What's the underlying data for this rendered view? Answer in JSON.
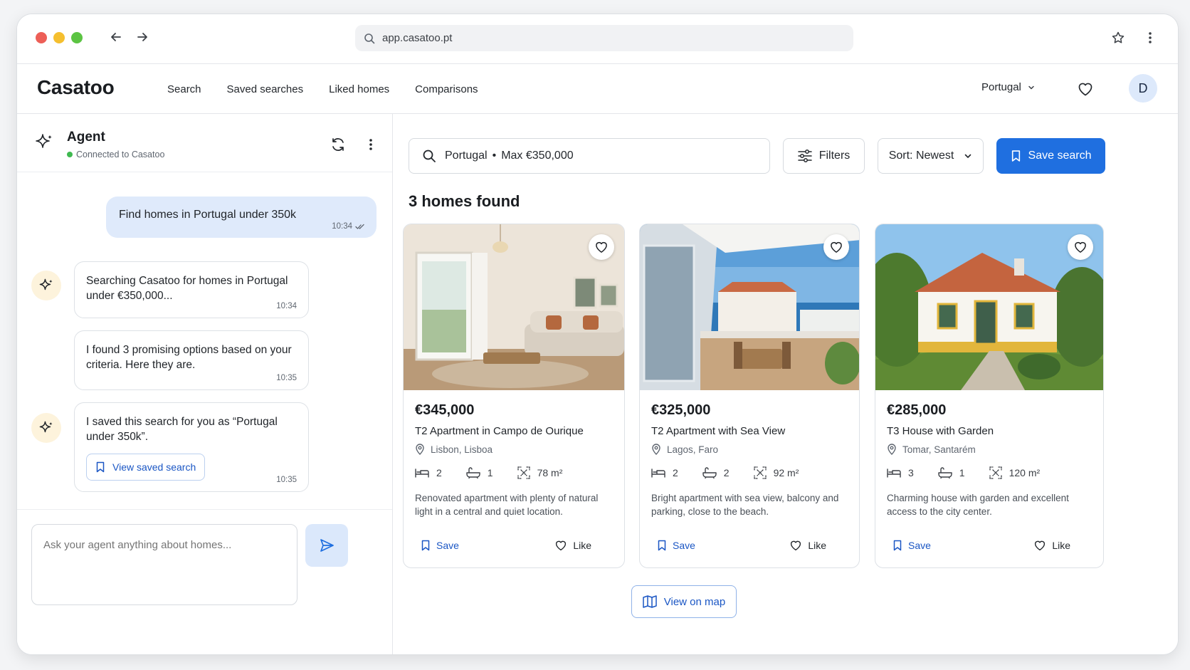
{
  "browser": {
    "url": "app.casatoo.pt"
  },
  "app": {
    "logo": "Casatoo",
    "nav": [
      "Search",
      "Saved searches",
      "Liked homes",
      "Comparisons"
    ],
    "country": "Portugal",
    "avatar_initial": "D"
  },
  "chat": {
    "title": "Agent",
    "status": "Connected to Casatoo",
    "user_message": {
      "text": "Find homes in Portugal under 350k",
      "time": "10:34"
    },
    "agent_messages": [
      {
        "text": "Searching Casatoo for homes in Portugal under €350,000...",
        "time": "10:34"
      },
      {
        "text": "I found 3 promising options based on your criteria. Here they are.",
        "time": "10:35"
      },
      {
        "text": "I saved this search for you as “Portugal under 350k”.",
        "time": "10:35",
        "button": "View saved search"
      }
    ],
    "input_placeholder": "Ask your agent anything about homes..."
  },
  "results": {
    "query_location": "Portugal",
    "query_separator": "•",
    "query_price": "Max €350,000",
    "filters_label": "Filters",
    "sort_label": "Sort: Newest",
    "save_search_label": "Save search",
    "count_label": "3 homes found",
    "map_button": "View on map",
    "listings": [
      {
        "price": "€345,000",
        "title": "T2 Apartment in Campo de Ourique",
        "location": "Lisbon, Lisboa",
        "beds": "2",
        "baths": "1",
        "area": "78 m²",
        "description": "Renovated apartment with plenty of natural light in a central and quiet location.",
        "save_label": "Save",
        "like_label": "Like"
      },
      {
        "price": "€325,000",
        "title": "T2 Apartment with Sea View",
        "location": "Lagos, Faro",
        "beds": "2",
        "baths": "2",
        "area": "92 m²",
        "description": "Bright apartment with sea view, balcony and parking, close to the beach.",
        "save_label": "Save",
        "like_label": "Like"
      },
      {
        "price": "€285,000",
        "title": "T3 House with Garden",
        "location": "Tomar, Santarém",
        "beds": "3",
        "baths": "1",
        "area": "120 m²",
        "description": "Charming house with garden and excellent access to the city center.",
        "save_label": "Save",
        "like_label": "Like"
      }
    ]
  },
  "colors": {
    "primary": "#1f6fe0",
    "link": "#1a56c4",
    "user_bubble": "#dfeafb",
    "agent_avatar_bg": "#fdf3dc",
    "status_online": "#3fb950"
  }
}
